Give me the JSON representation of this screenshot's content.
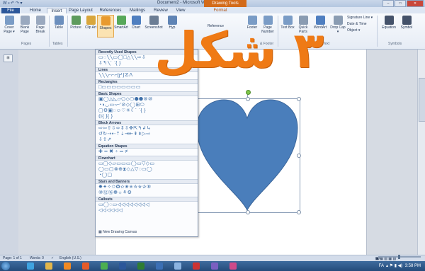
{
  "window": {
    "doc_title": "Document2 - Microsoft Word",
    "context_tab": "Drawing Tools",
    "qat": "W ▪ ↶ ↷ ▾",
    "controls": [
      "–",
      "□",
      "✕"
    ]
  },
  "tabs": [
    "File",
    "Home",
    "Insert",
    "Page Layout",
    "References",
    "Mailings",
    "Review",
    "View",
    "Format"
  ],
  "ribbon": {
    "buttons": [
      {
        "label": "Cover Page ▾",
        "color": "#7a9cc6"
      },
      {
        "label": "Blank Page",
        "color": "#9aa9bf"
      },
      {
        "label": "Page Break",
        "color": "#9aa9bf"
      },
      {
        "label": "Table",
        "color": "#6c8fbd"
      },
      {
        "label": "Picture",
        "color": "#5d9b5d"
      },
      {
        "label": "Clip Art",
        "color": "#d8a63c"
      },
      {
        "label": "Shapes",
        "color": "#e89a2e"
      },
      {
        "label": "SmartArt",
        "color": "#57a85a"
      },
      {
        "label": "Chart",
        "color": "#4f7fc0"
      },
      {
        "label": "Screenshot",
        "color": "#6b7d94"
      },
      {
        "label": "Hyp",
        "color": "#5f84b5"
      },
      {
        "label": "Footer",
        "color": "#7a9cc6"
      },
      {
        "label": "Page Number",
        "color": "#7a9cc6"
      },
      {
        "label": "Text Box",
        "color": "#7a9cc6"
      },
      {
        "label": "Quick Parts",
        "color": "#8a9cb2"
      },
      {
        "label": "WordArt",
        "color": "#4f7fc0"
      },
      {
        "label": "Drop Cap ▾",
        "color": "#8a9cb2"
      },
      {
        "label": "Equation",
        "color": "#44526a"
      },
      {
        "label": "Symbol",
        "color": "#44526a"
      }
    ],
    "groups": [
      "Pages",
      "Tables",
      "& Footer",
      "Text",
      "Symbols"
    ],
    "partial_label": "Reference",
    "small_items": [
      "Signature Line ▾",
      "Date & Time",
      "Object ▾"
    ]
  },
  "overlay_text": "٣ شكل",
  "shapes_menu": {
    "sections": [
      {
        "title": "Recently Used Shapes",
        "rows": [
          "▭◌╲╲▭◯□△╲╲⇨⇩",
          "⇩↰╲⌒{ }"
        ]
      },
      {
        "title": "Lines",
        "rows": [
          "╲╲╲⌐⌐⌐ʅʅ╯ʃ☡ⴷ"
        ]
      },
      {
        "title": "Rectangles",
        "rows": [
          "□▭▭▭▭▭▭▭▭"
        ]
      },
      {
        "title": "Basic Shapes",
        "rows": [
          "▣◯△◺▱⬠◇⬡⬢⬣⑧⑩",
          "◔◑◡▭▫⌐◜⊘◇◯⊞⬭",
          "▢⚙▣◌☺♡☀☾⌒{ }",
          "⦅⦆{ }{ }"
        ]
      },
      {
        "title": "Block Arrows",
        "rows": [
          "⇨⇦⇧⇩⬄⇕⇳✥⇱↰↲↳",
          "↺↻⇢⇠⇡⇣⇥⇤⇞⇟▷⇨",
          "⇩⇧⇗"
        ]
      },
      {
        "title": "Equation Shapes",
        "rows": [
          "✚ ━ ✖ ÷ ═ ≠"
        ]
      },
      {
        "title": "Flowchart",
        "rows": [
          "▭▢◇▱▭▭▭◯▭▽◇▭",
          "◯▭▢⊗⊕⧗◇△▽◌▭◯",
          "◔◯▢"
        ]
      },
      {
        "title": "Stars and Banners",
        "rows": [
          "✸✦✧✩✪✫✬✭✮✯✰⑧",
          "⑩⑫⑯❁☼⚘⚙"
        ]
      },
      {
        "title": "Callouts",
        "rows": [
          "▭◯◌▭◁◁◁◁◁◁◁◁",
          "◁◁◁◁◁◁"
        ]
      }
    ],
    "new_canvas": "New Drawing Canvas"
  },
  "status": {
    "page": "Page: 1 of 1",
    "words": "Words: 0",
    "lang": "English (U.S.)",
    "zoom": "80%"
  },
  "tray": {
    "lang": "FA",
    "time": "3:58 PM"
  },
  "shape": {
    "fill": "#4a7ebb",
    "stroke": "#3a659a"
  },
  "taskbar_apps": [
    {
      "name": "ie-icon",
      "color": "#3fa3e0"
    },
    {
      "name": "folder-icon",
      "color": "#e3b64a"
    },
    {
      "name": "media-icon",
      "color": "#f18a24"
    },
    {
      "name": "firefox-icon",
      "color": "#e55b2a"
    },
    {
      "name": "chrome-icon",
      "color": "#4caf50"
    },
    {
      "name": "word-icon",
      "color": "#2b579a"
    },
    {
      "name": "excel-icon",
      "color": "#2e7d32"
    },
    {
      "name": "outlook-icon",
      "color": "#3b6fb4"
    },
    {
      "name": "explorer-icon",
      "color": "#8bb3e0"
    },
    {
      "name": "app-icon",
      "color": "#cc3333"
    },
    {
      "name": "app2-icon",
      "color": "#7a5fc0"
    },
    {
      "name": "app3-icon",
      "color": "#d04a8a"
    }
  ]
}
